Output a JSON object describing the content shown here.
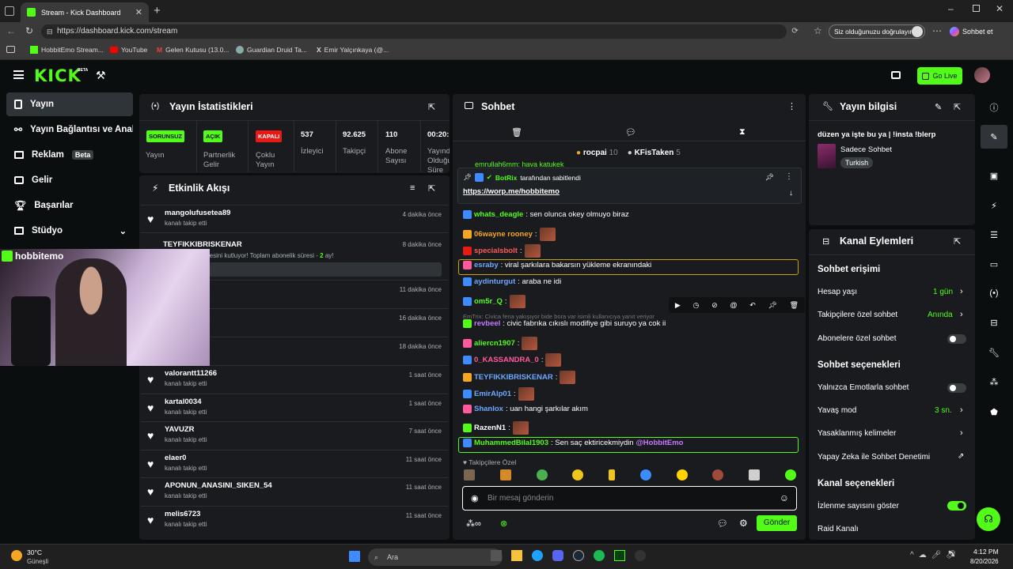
{
  "browser": {
    "tab_title": "Stream - Kick Dashboard",
    "url": "https://dashboard.kick.com/stream",
    "verify_btn": "Siz olduğunuzu doğrulayın",
    "sohbet_et": "Sohbet et",
    "bookmarks": [
      "HobbitEmo Stream...",
      "YouTube",
      "Gelen Kutusu (13.0...",
      "Guardian Druid Ta...",
      "Emir Yalçınkaya (@..."
    ]
  },
  "header": {
    "logo": "KICK",
    "beta": "BETA",
    "go_live": "Go Live"
  },
  "sidebar": {
    "items": [
      {
        "label": "Yayın"
      },
      {
        "label": "Yayın Bağlantısı ve Anahtarı"
      },
      {
        "label": "Reklam",
        "badge": "Beta"
      },
      {
        "label": "Gelir"
      },
      {
        "label": "Başarılar"
      },
      {
        "label": "Stüdyo"
      }
    ]
  },
  "stats": {
    "title": "Yayın İstatistikleri",
    "cols": [
      {
        "pill": "SORUNSUZ",
        "pill_color": "#53fc18",
        "label": "Yayın"
      },
      {
        "pill": "AÇIK",
        "pill_color": "#53fc18",
        "label": "Partnerlik Gelir"
      },
      {
        "pill": "KAPALI",
        "pill_color": "#e91916",
        "label": "Çoklu Yayın"
      },
      {
        "value": "537",
        "label": "İzleyici"
      },
      {
        "value": "92.625",
        "label": "Takipçi"
      },
      {
        "value": "110",
        "label": "Abone Sayısı"
      },
      {
        "value": "00:20:",
        "label": "Yayında Olduğu Süre"
      }
    ]
  },
  "feed": {
    "title": "Etkinlik Akışı",
    "webcam_name": "hobbitemo",
    "top_items": [
      {
        "name": "mangolufusetea89",
        "sub": "kanalı takip etti",
        "time": "4 dakika önce"
      },
      {
        "name": "TEYFIKKIBRISKENAR",
        "sub": "mesini kutluyor! Toplam abonelik süresi - ",
        "sub_highlight": "2",
        "sub_tail": " ay!",
        "time": "8 dakika önce"
      }
    ],
    "mid_items": [
      {
        "name": "",
        "time": "11 dakika önce"
      },
      {
        "name": "3",
        "time": "16 dakika önce"
      },
      {
        "name": "",
        "time": "18 dakika önce"
      }
    ],
    "items": [
      {
        "name": "valorantt11266",
        "sub": "kanalı takip etti",
        "time": "1 saat önce"
      },
      {
        "name": "kartal0034",
        "sub": "kanalı takip etti",
        "time": "1 saat önce"
      },
      {
        "name": "YAVUZR",
        "sub": "kanalı takip etti",
        "time": "7 saat önce"
      },
      {
        "name": "elaer0",
        "sub": "kanalı takip etti",
        "time": "11 saat önce"
      },
      {
        "name": "APONUN_ANASINI_SIKEN_54",
        "sub": "kanalı takip etti",
        "time": "11 saat önce"
      },
      {
        "name": "melis6723",
        "sub": "kanalı takip etti",
        "time": "11 saat önce"
      }
    ]
  },
  "chat": {
    "title": "Sohbet",
    "top_gifters": [
      {
        "name": "rocpai",
        "count": "10"
      },
      {
        "name": "KFisTaken",
        "count": "5"
      }
    ],
    "hidden_top": "emrullah6mm: haya katukek",
    "pinned": {
      "by": "BotRix",
      "by_suffix": "tarafından sabitlendi",
      "link": "https://worp.me/hobbitemo"
    },
    "messages": [
      {
        "user": "whats_deagle",
        "color": "#53fc18",
        "text": ": sen olunca okey olmuyo biraz",
        "emote": false
      },
      {
        "user": "06wayne rooney",
        "color": "#f5a623",
        "text": ":",
        "emote": true
      },
      {
        "user": "specialsbolt",
        "color": "#ff5a5a",
        "text": ":",
        "emote": true
      },
      {
        "user": "esraby",
        "color": "#6fa8ff",
        "text": ": viral şarkılara bakarsın yükleme ekranındaki",
        "emote": false,
        "highlight": true
      },
      {
        "user": "aydinturgut",
        "color": "#6fa8ff",
        "text": ": araba ne idi",
        "emote": false
      },
      {
        "user": "om5r_Q",
        "color": "#53fc18",
        "text": ":",
        "emote": true
      },
      {
        "user": "revbeel",
        "color": "#c779ff",
        "text": ": civic fabrıka cıkıslı modifiye gibi suruyo ya cok ii",
        "emote": false,
        "reply": "EmTrix: Civica fena yakışıyor bide bora var isimli kullanıcıya yanıt veriyor"
      },
      {
        "user": "aliercn1907",
        "color": "#53fc18",
        "text": ":",
        "emote": true
      },
      {
        "user": "0_KASSANDRA_0",
        "color": "#ff5a9e",
        "text": ":",
        "emote": true
      },
      {
        "user": "TEYFIKKIBRISKENAR",
        "color": "#6fa8ff",
        "text": ":",
        "emote": true
      },
      {
        "user": "EmirAlp01",
        "color": "#6fa8ff",
        "text": ":",
        "emote": true
      },
      {
        "user": "Shanlox",
        "color": "#6fa8ff",
        "text": ": uan hangi şarkılar akım",
        "emote": false
      },
      {
        "user": "RazenN1",
        "color": "#ffffff",
        "text": ":",
        "emote": true
      },
      {
        "user": "MuhammedBilal1903",
        "color": "#53fc18",
        "text": ": Sen saç ektiricekmiydin ",
        "mention": "@HobbitEmo",
        "emote": false,
        "highlight": true
      }
    ],
    "followers_only": "Takipçilere Özel",
    "input_placeholder": "Bir mesaj gönderin",
    "send": "Gönder"
  },
  "info": {
    "title": "Yayın bilgisi",
    "stream_title": "düzen ya işte bu ya | !insta !blerp",
    "category": "Sadece Sohbet",
    "tag": "Turkish"
  },
  "actions": {
    "title": "Kanal Eylemleri",
    "section1": "Sohbet erişimi",
    "hesap_yasi": "Hesap yaşı",
    "hesap_yasi_val": "1 gün",
    "takipci_ozel": "Takipçilere özel sohbet",
    "takipci_ozel_val": "Anında",
    "abone_ozel": "Abonelere özel sohbet",
    "section2": "Sohbet seçenekleri",
    "emote_only": "Yalnızca Emotlarla sohbet",
    "slow_mode": "Yavaş mod",
    "slow_mode_val": "3 sn.",
    "banned_words": "Yasaklanmış kelimeler",
    "ai_mod": "Yapay Zeka ile Sohbet Denetimi",
    "section3": "Kanal seçenekleri",
    "viewer_count": "İzlenme sayısını göster",
    "raid": "Raid Kanalı"
  },
  "taskbar": {
    "temp": "30°C",
    "weather": "Güneşli",
    "search": "Ara",
    "time": "4:12 PM",
    "date": "8/20/2026"
  }
}
